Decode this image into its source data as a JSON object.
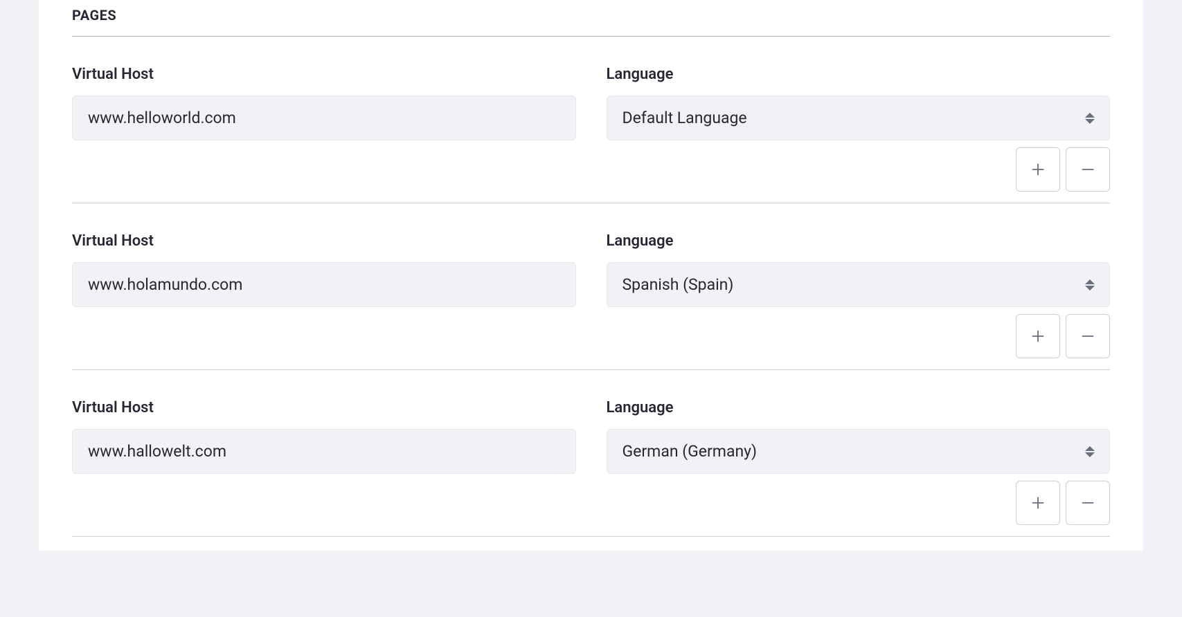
{
  "section": {
    "title": "PAGES"
  },
  "labels": {
    "virtual_host": "Virtual Host",
    "language": "Language"
  },
  "rows": [
    {
      "host": "www.helloworld.com",
      "language": "Default Language"
    },
    {
      "host": "www.holamundo.com",
      "language": "Spanish (Spain)"
    },
    {
      "host": "www.hallowelt.com",
      "language": "German (Germany)"
    }
  ]
}
